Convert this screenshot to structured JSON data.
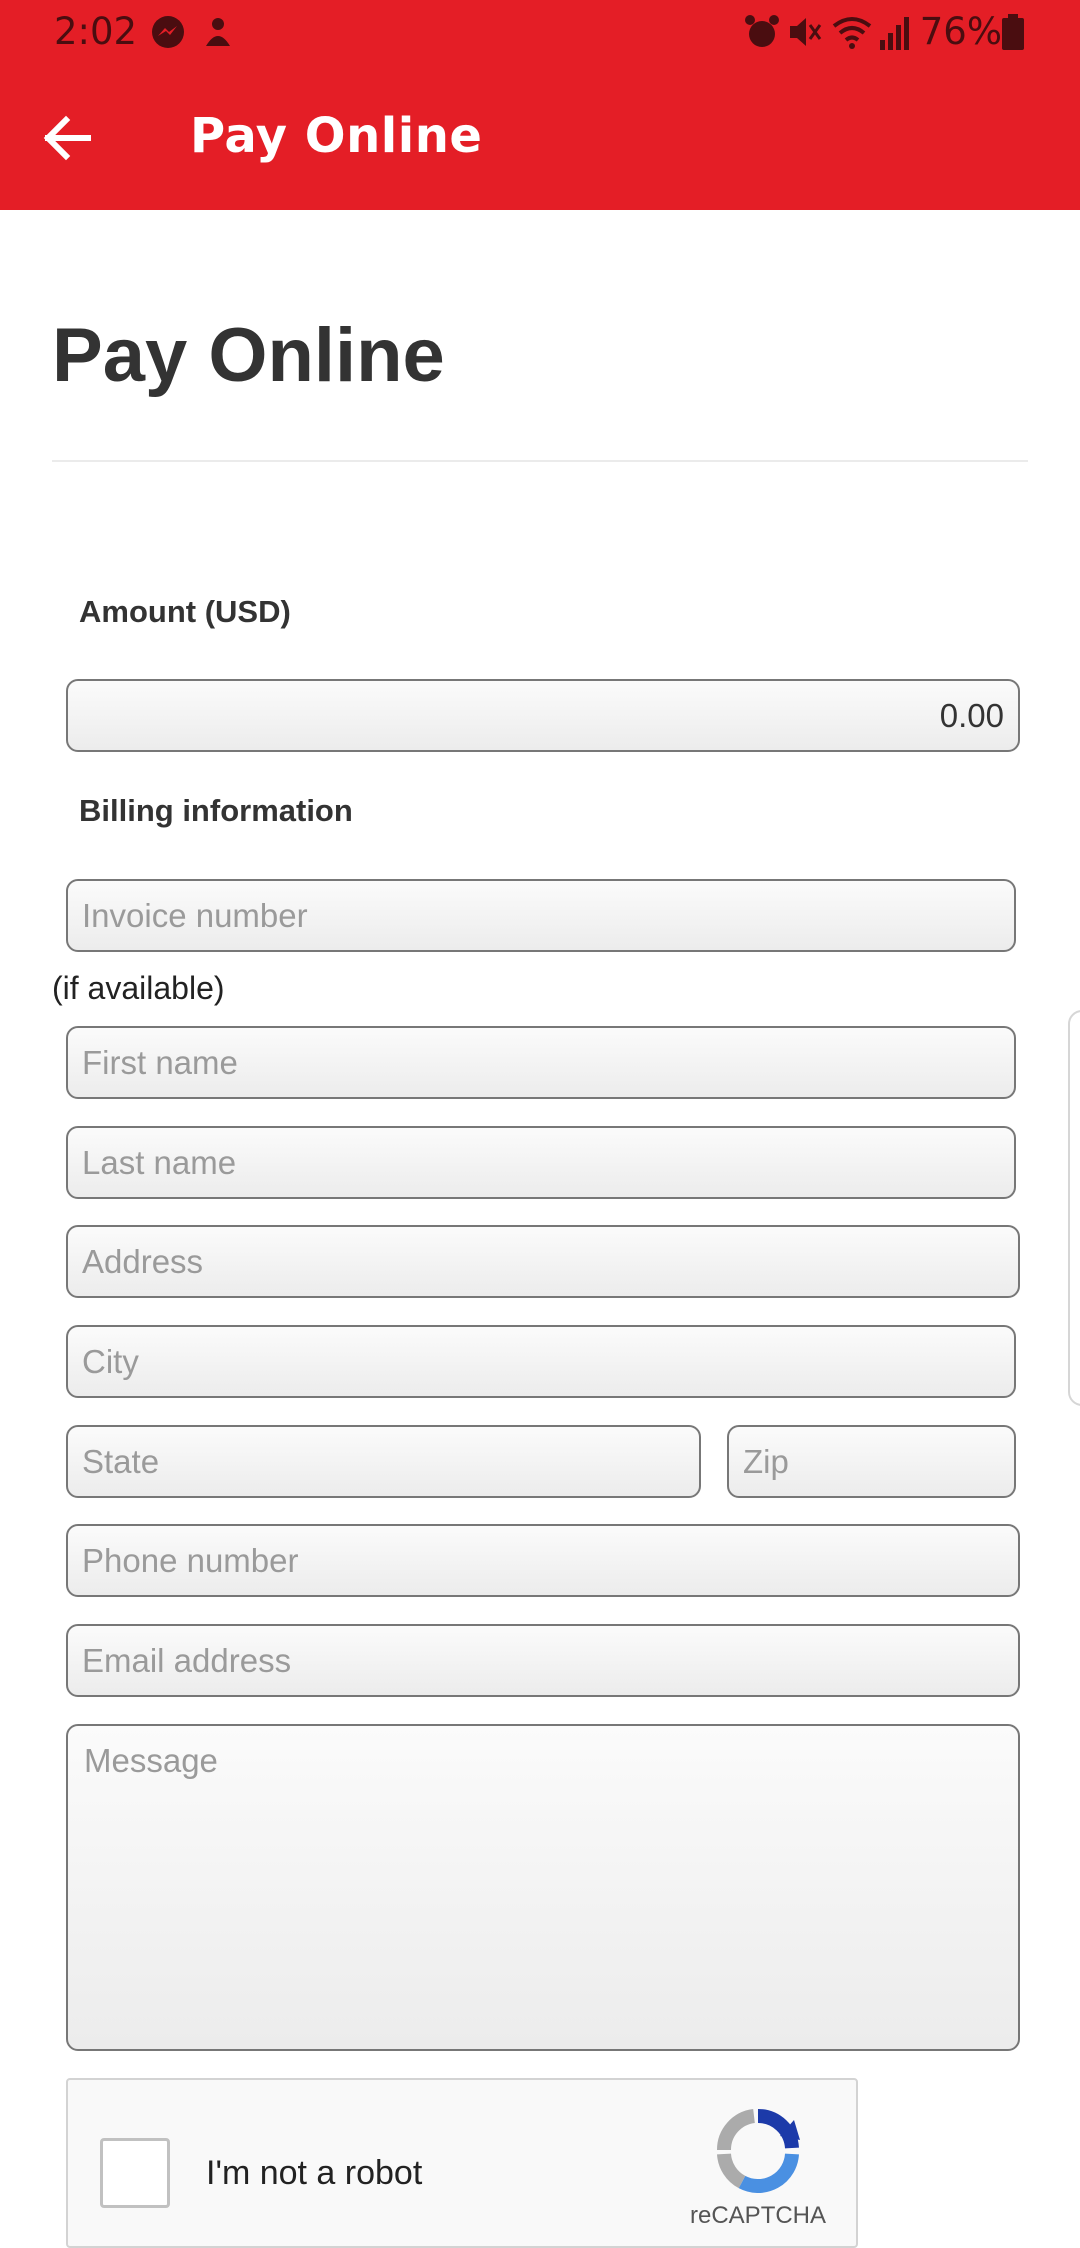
{
  "status_bar": {
    "time": "2:02",
    "battery": "76%",
    "icons": [
      "messenger-icon",
      "game-app-icon",
      "alarm-icon",
      "mute-icon",
      "wifi-icon",
      "signal-icon",
      "battery-icon"
    ]
  },
  "app_bar": {
    "title": "Pay Online",
    "back_icon": "arrow-left-icon",
    "color": "#e41e26"
  },
  "page": {
    "heading": "Pay Online"
  },
  "form": {
    "amount_label": "Amount (USD)",
    "amount_value": "0.00",
    "billing_label": "Billing information",
    "invoice_placeholder": "Invoice number",
    "invoice_helper": "(if available)",
    "first_name_placeholder": "First name",
    "last_name_placeholder": "Last name",
    "address_placeholder": "Address",
    "city_placeholder": "City",
    "state_placeholder": "State",
    "zip_placeholder": "Zip",
    "phone_placeholder": "Phone number",
    "email_placeholder": "Email address",
    "message_placeholder": "Message"
  },
  "recaptcha": {
    "label": "I'm not a robot",
    "brand": "reCAPTCHA",
    "icon": "recaptcha-logo-icon"
  }
}
